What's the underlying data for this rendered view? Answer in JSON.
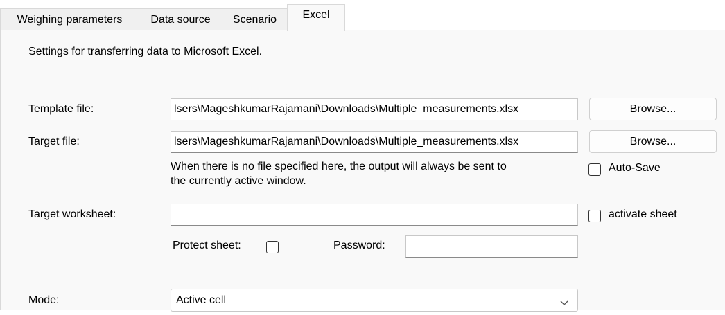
{
  "tabs": [
    {
      "label": "Weighing parameters"
    },
    {
      "label": "Data source"
    },
    {
      "label": "Scenario"
    },
    {
      "label": "Excel"
    }
  ],
  "active_tab": "Excel",
  "description": "Settings for transferring data to Microsoft Excel.",
  "template_file": {
    "label": "Template file:",
    "value": "lsers\\MageshkumarRajamani\\Downloads\\Multiple_measurements.xlsx",
    "browse_label": "Browse..."
  },
  "target_file": {
    "label": "Target file:",
    "value": "lsers\\MageshkumarRajamani\\Downloads\\Multiple_measurements.xlsx",
    "browse_label": "Browse...",
    "hint_line1": "When there is no file specified here, the output will always be sent to",
    "hint_line2": "the currently active window."
  },
  "auto_save": {
    "label": "Auto-Save",
    "checked": false
  },
  "target_worksheet": {
    "label": "Target worksheet:",
    "value": ""
  },
  "activate_sheet": {
    "label": "activate sheet",
    "checked": false
  },
  "protect_sheet": {
    "label": "Protect sheet:",
    "checked": false
  },
  "password": {
    "label": "Password:",
    "value": ""
  },
  "mode": {
    "label": "Mode:",
    "selected": "Active cell"
  },
  "icons": {
    "dropdown": "chevron-down-icon"
  }
}
